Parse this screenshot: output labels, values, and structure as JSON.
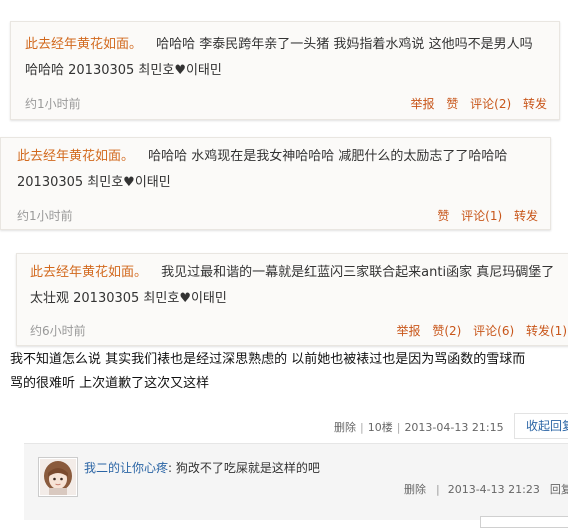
{
  "comments": [
    {
      "author": "此去经年黄花如面",
      "sep": "。",
      "text": "哈哈哈 李泰民跨年亲了一头猪 我妈指着水鸡说 这他吗不是男人吗 哈哈哈 20130305 최민호♥이태민",
      "time": "约1小时前",
      "report": "举报",
      "like": "赞",
      "comment": "评论(2)",
      "forward": "转发"
    },
    {
      "author": "此去经年黄花如面",
      "sep": "。",
      "text": "哈哈哈 水鸡现在是我女神哈哈哈 减肥什么的太励志了了哈哈哈 20130305 최민호♥이태민",
      "time": "约1小时前",
      "like": "赞",
      "comment": "评论(1)",
      "forward": "转发"
    },
    {
      "author": "此去经年黄花如面",
      "sep": "。",
      "text": "我见过最和谐的一幕就是红蓝闪三家联合起来anti函家 真尼玛碉堡了 太壮观 20130305 최민호♥이태민",
      "time": "约6小时前",
      "report": "举报",
      "like": "赞(2)",
      "comment": "评论(6)",
      "forward": "转发(1)"
    }
  ],
  "main_post": {
    "line1": "我不知道怎么说 其实我们裱也是经过深思熟虑的 以前她也被裱过也是因为骂函数的雪球而",
    "line2": "骂的很难听 上次道歉了这次又这样"
  },
  "floor_bar": {
    "delete": "删除",
    "floor": "10楼",
    "timestamp": "2013-04-13 21:15",
    "toggle": "收起回复"
  },
  "reply": {
    "user": "我二的让你心疼",
    "colon": ":",
    "text": "狗改不了吃屎就是这样的吧",
    "delete": "删除",
    "timestamp": "2013-4-13 21:23",
    "reply_label": "回复"
  }
}
